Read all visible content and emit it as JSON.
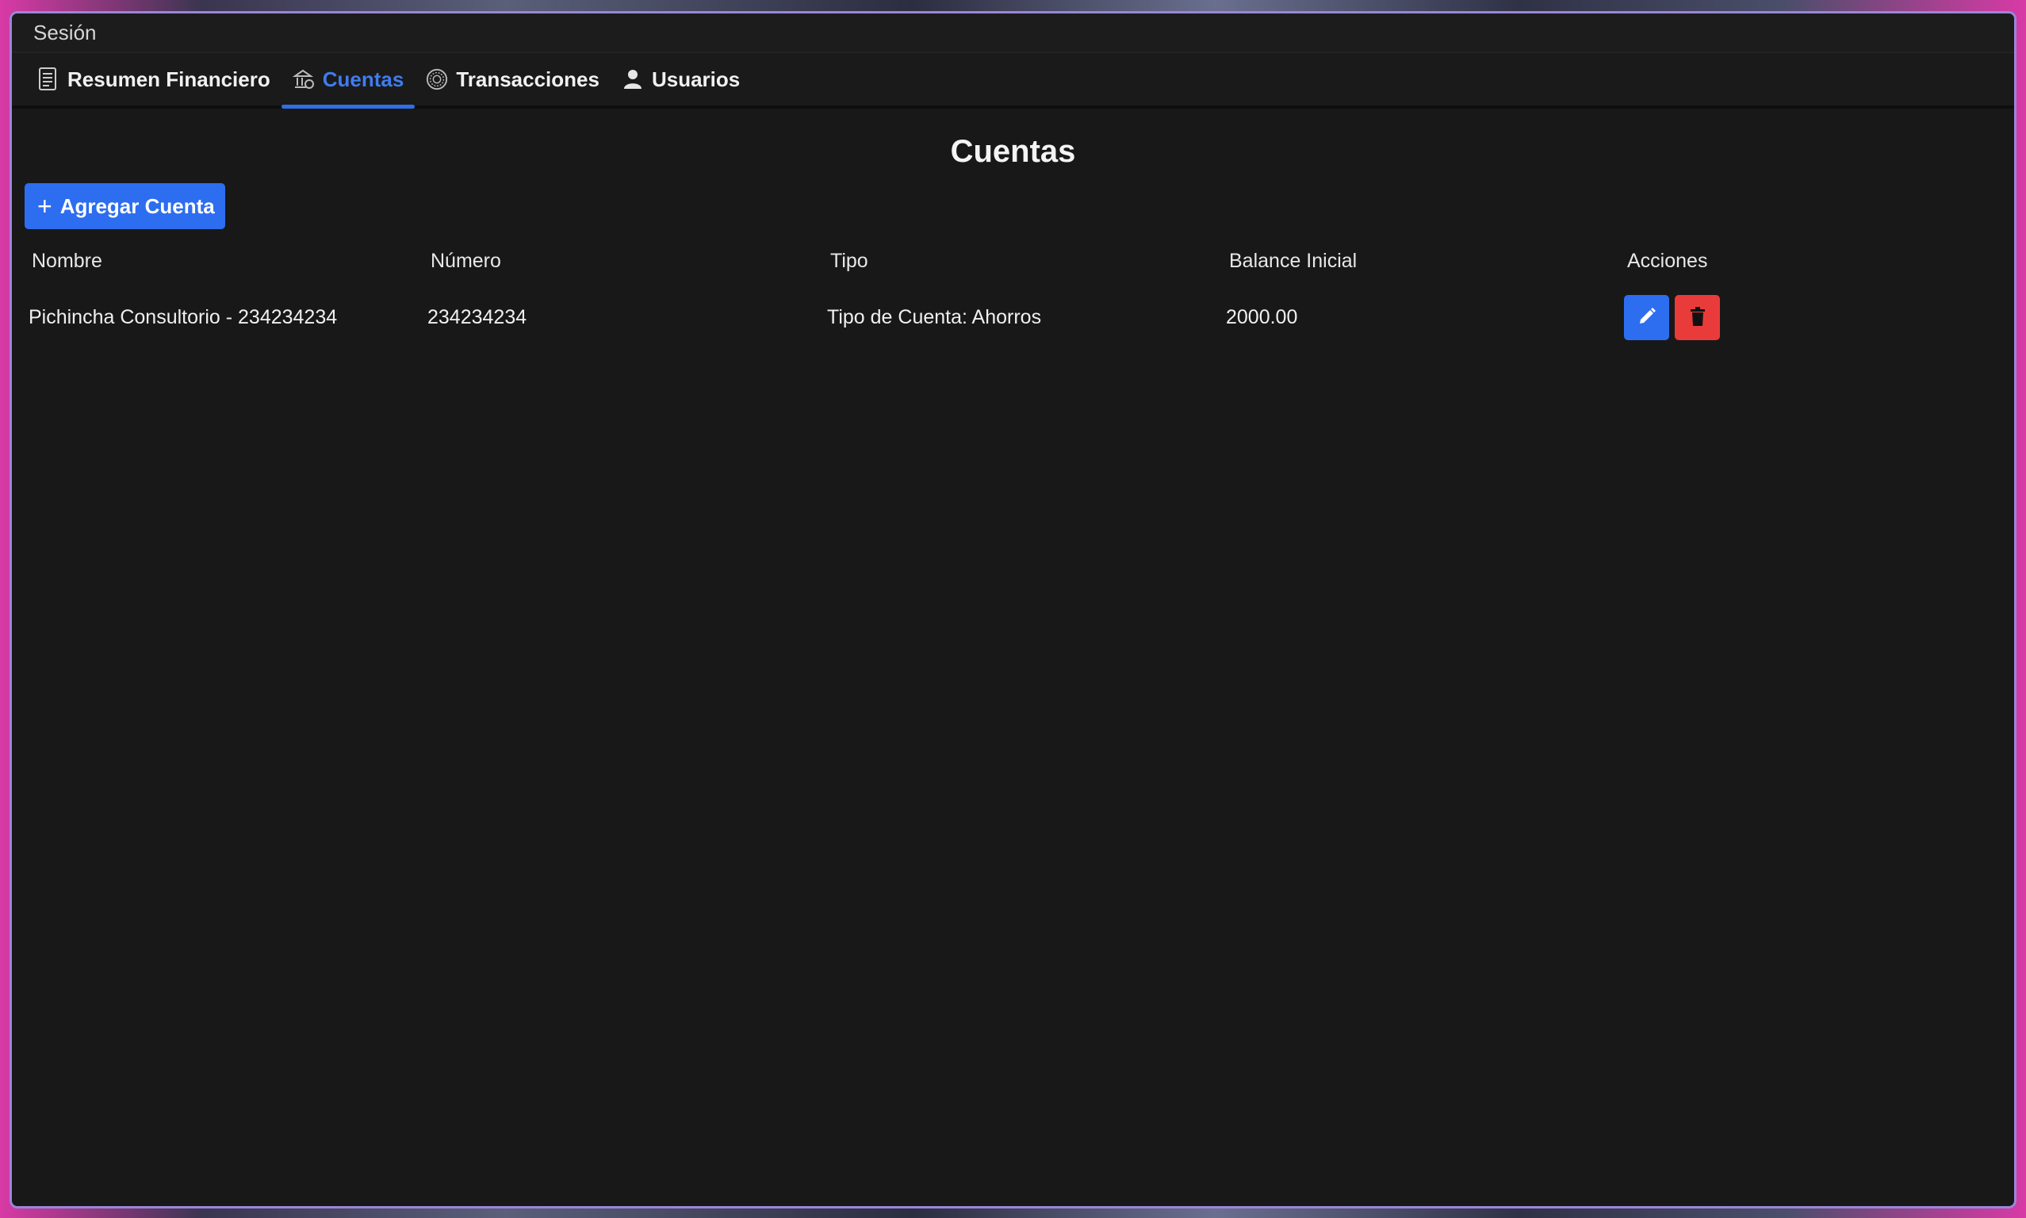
{
  "menu": {
    "session_label": "Sesión"
  },
  "tabs": [
    {
      "label": "Resumen Financiero",
      "icon": "document-list-icon",
      "active": false
    },
    {
      "label": "Cuentas",
      "icon": "bank-icon",
      "active": true
    },
    {
      "label": "Transacciones",
      "icon": "coin-icon",
      "active": false
    },
    {
      "label": "Usuarios",
      "icon": "user-icon",
      "active": false
    }
  ],
  "page": {
    "title": "Cuentas",
    "add_button_label": "Agregar Cuenta"
  },
  "table": {
    "headers": [
      "Nombre",
      "Número",
      "Tipo",
      "Balance Inicial",
      "Acciones"
    ],
    "rows": [
      {
        "nombre": "Pichincha Consultorio - 234234234",
        "numero": "234234234",
        "tipo": "Tipo de Cuenta: Ahorros",
        "balance": "2000.00"
      }
    ]
  },
  "colors": {
    "accent": "#2d6df0",
    "danger": "#ea3b3b",
    "background": "#181818"
  }
}
